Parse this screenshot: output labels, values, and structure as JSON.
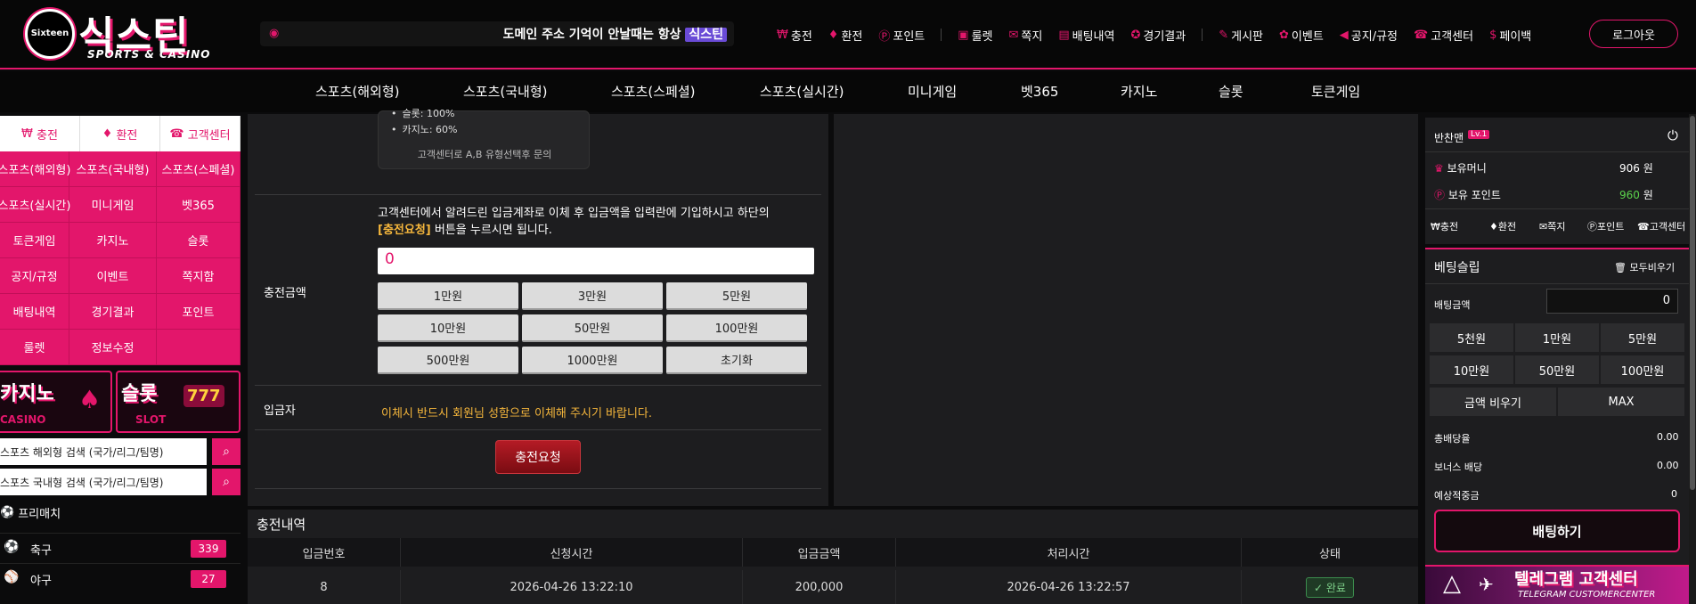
{
  "logo": {
    "badge": "Sixteen",
    "main": "식스틴",
    "sub": "SPORTS & CASINO"
  },
  "notice": {
    "text": "도메인 주소 기억이 안날때는 항상 ",
    "highlight": "식스틴"
  },
  "top_nav": [
    {
      "icon": "coin-icon",
      "glyph": "₩",
      "label": "충전"
    },
    {
      "icon": "money-bag-icon",
      "glyph": "♦",
      "label": "환전"
    },
    {
      "icon": "point-icon",
      "glyph": "Ⓟ",
      "label": "포인트"
    },
    {
      "icon": "roulette-icon",
      "glyph": "▣",
      "label": "룰렛"
    },
    {
      "icon": "mail-icon",
      "glyph": "✉",
      "label": "쪽지"
    },
    {
      "icon": "list-icon",
      "glyph": "▤",
      "label": "배팅내역"
    },
    {
      "icon": "medal-icon",
      "glyph": "✪",
      "label": "경기결과"
    },
    {
      "icon": "chat-icon",
      "glyph": "✎",
      "label": "게시판"
    },
    {
      "icon": "gift-icon",
      "glyph": "✿",
      "label": "이벤트"
    },
    {
      "icon": "megaphone-icon",
      "glyph": "◀",
      "label": "공지/규정"
    },
    {
      "icon": "headset-icon",
      "glyph": "☎",
      "label": "고객센터"
    },
    {
      "icon": "payback-icon",
      "glyph": "$",
      "label": "페이백"
    }
  ],
  "logout_label": "로그아웃",
  "main_nav": [
    "스포츠(해외형)",
    "스포츠(국내형)",
    "스포츠(스페셜)",
    "스포츠(실시간)",
    "미니게임",
    "벳365",
    "카지노",
    "슬롯",
    "토큰게임"
  ],
  "left": {
    "top_tabs": [
      "충전",
      "환전",
      "고객센터"
    ],
    "grid": [
      "스포츠(해외형)",
      "스포츠(국내형)",
      "스포츠(스페셜)",
      "스포츠(실시간)",
      "미니게임",
      "벳365",
      "토큰게임",
      "카지노",
      "슬롯",
      "공지/규정",
      "이벤트",
      "쪽지함",
      "배팅내역",
      "경기결과",
      "포인트",
      "룰렛",
      "정보수정",
      ""
    ],
    "casino_banner": {
      "title": "카지노",
      "sub": "CASINO"
    },
    "slot_banner": {
      "title": "슬롯",
      "sub": "SLOT"
    },
    "search1": "스포츠 해외형 검색 (국가/리그/팀명)",
    "search2": "스포츠 국내형 검색 (국가/리그/팀명)",
    "prematch": "프리매치",
    "sports": [
      {
        "name": "축구",
        "count": "339"
      },
      {
        "name": "야구",
        "count": "27"
      }
    ]
  },
  "deposit": {
    "info_items": [
      "슬롯: 100%",
      "카지노: 60%"
    ],
    "info_note": "고객센터로 A,B 유형선택후 문의",
    "desc_line1": "고객센터에서 알려드린 입금계좌로 이체 후 입금액을 입력란에 기입하시고 하단의",
    "desc_hl": "[충전요청]",
    "desc_line2": " 버튼을 누르시면 됩니다.",
    "amount_label": "충전금액",
    "amount_value": "0",
    "amount_buttons": [
      "1만원",
      "3만원",
      "5만원",
      "10만원",
      "50만원",
      "100만원",
      "500만원",
      "1000만원",
      "초기화"
    ],
    "depositor_label": "입금자",
    "depositor_note": "이체시 반드시 회원님 성함으로 이체해 주시기 바랍니다.",
    "request_button": "충전요청"
  },
  "history": {
    "title": "충전내역",
    "columns": [
      "입금번호",
      "신청시간",
      "입금금액",
      "처리시간",
      "상태"
    ],
    "rows": [
      {
        "no": "8",
        "requested": "2026-04-26 13:22:10",
        "amount": "200,000",
        "processed": "2026-04-26 13:22:57",
        "status": "완료"
      }
    ]
  },
  "user": {
    "name": "반찬맨",
    "level": "Lv.1",
    "money_label": "보유머니",
    "money": "906",
    "point_label": "보유 포인트",
    "point": "960",
    "unit": "원",
    "quick": [
      "충전",
      "환전",
      "쪽지",
      "포인트",
      "고객센터"
    ]
  },
  "slip": {
    "title": "베팅슬립",
    "clear_all": "모두비우기",
    "amount_label": "배팅금액",
    "amount_value": "0",
    "buttons": [
      "5천원",
      "1만원",
      "5만원",
      "10만원",
      "50만원",
      "100만원"
    ],
    "clear_amount": "금액 비우기",
    "max": "MAX",
    "total_odds_label": "총배당율",
    "total_odds": "0.00",
    "bonus_label": "보너스 배당",
    "bonus": "0.00",
    "expected_label": "예상적중금",
    "expected": "0",
    "bet_button": "배팅하기"
  },
  "telegram_banner": {
    "title": "텔레그램 고객센터",
    "sub": "TELEGRAM CUSTOMERCENTER"
  },
  "colors": {
    "accent": "#e3166b",
    "highlight": "#f6b73c",
    "background": "#0b0b0c",
    "panel": "#1d1d1f"
  }
}
